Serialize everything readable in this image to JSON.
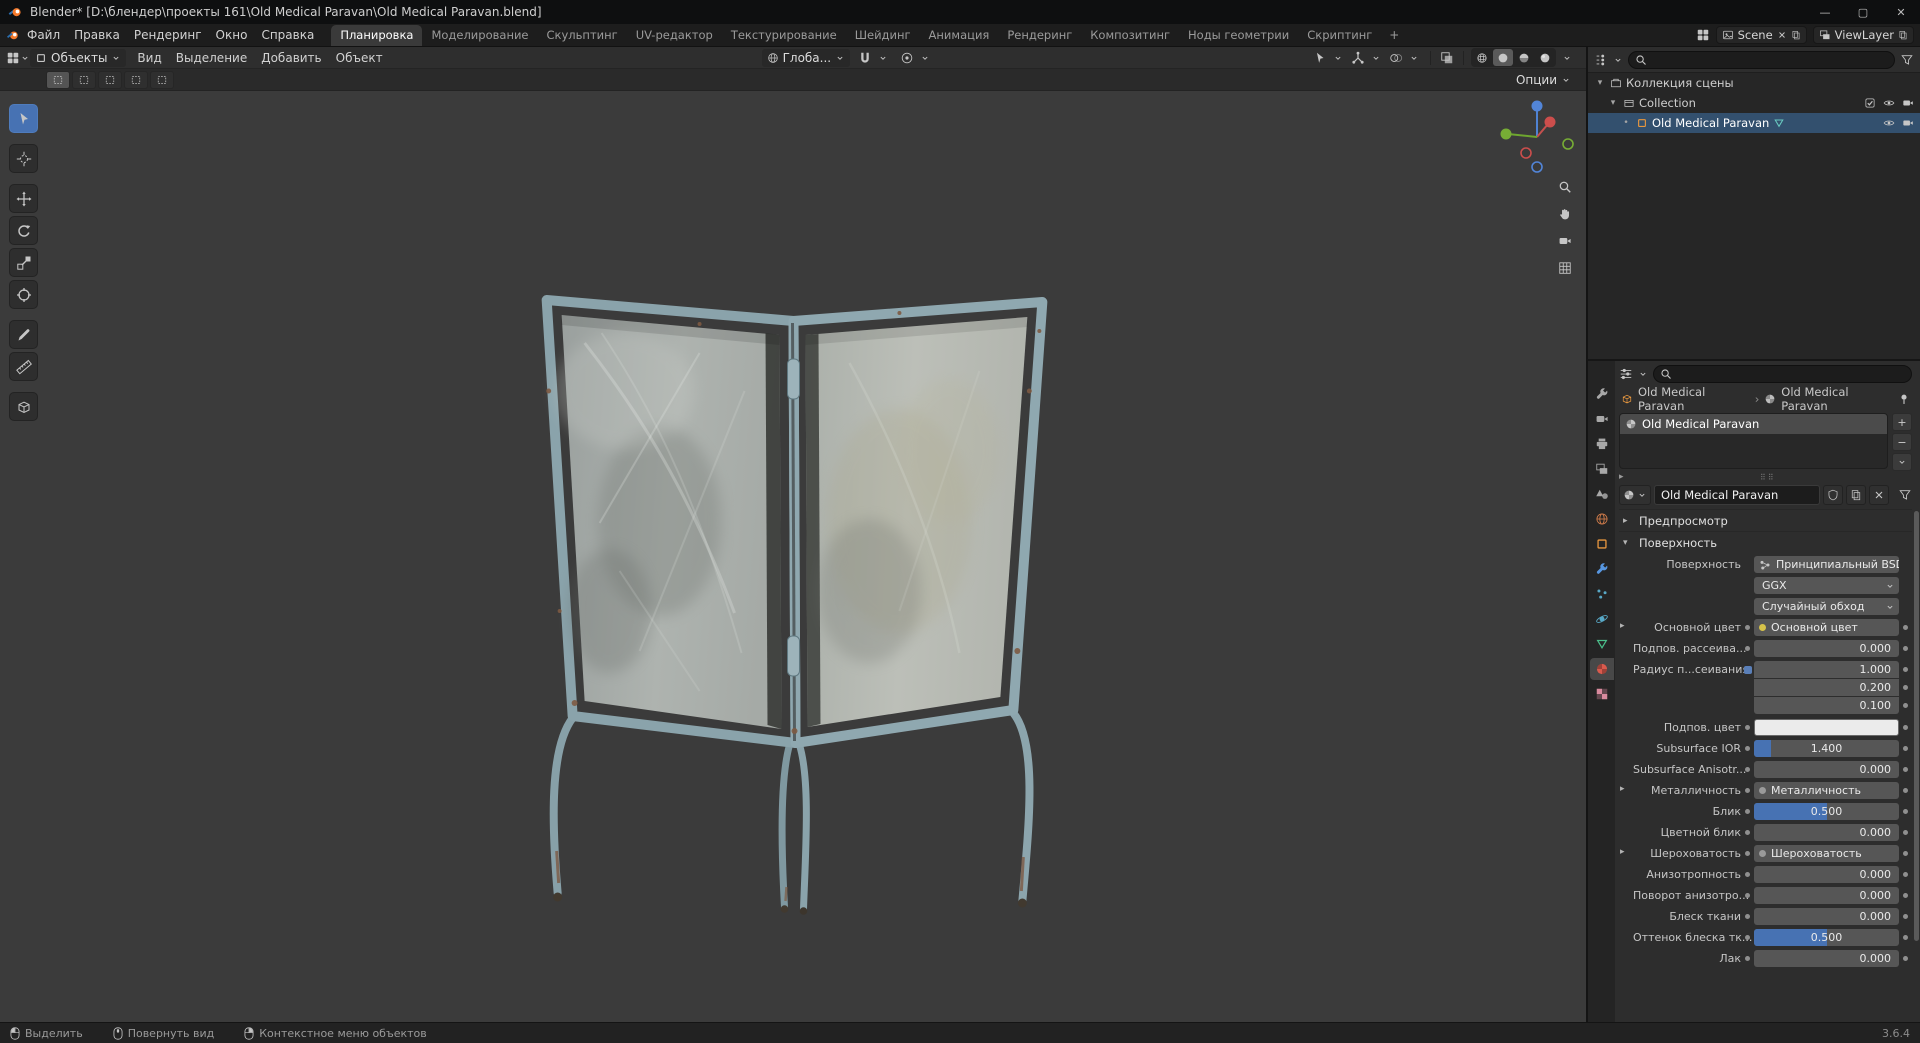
{
  "titlebar": {
    "title": "Blender* [D:\\блендер\\проекты 161\\Old Medical Paravan\\Old Medical Paravan.blend]",
    "minimize_glyph": "—",
    "maximize_glyph": "▢",
    "close_glyph": "✕"
  },
  "topbar": {
    "menus": [
      {
        "label": "Файл"
      },
      {
        "label": "Правка"
      },
      {
        "label": "Рендеринг"
      },
      {
        "label": "Окно"
      },
      {
        "label": "Справка"
      }
    ],
    "workspaces": [
      {
        "label": "Планировка",
        "active": true
      },
      {
        "label": "Моделирование"
      },
      {
        "label": "Скульптинг"
      },
      {
        "label": "UV-редактор"
      },
      {
        "label": "Текстурирование"
      },
      {
        "label": "Шейдинг"
      },
      {
        "label": "Анимация"
      },
      {
        "label": "Рендеринг"
      },
      {
        "label": "Композитинг"
      },
      {
        "label": "Ноды геометрии"
      },
      {
        "label": "Скриптинг"
      }
    ],
    "add_workspace_label": "+",
    "scene": {
      "label": "Scene"
    },
    "view_layer": {
      "label": "ViewLayer"
    }
  },
  "viewport": {
    "header": {
      "mode": "Объекты",
      "menus": [
        {
          "label": "Вид"
        },
        {
          "label": "Выделение"
        },
        {
          "label": "Добавить"
        },
        {
          "label": "Объект"
        }
      ],
      "orientation": "Глоба...",
      "options_label": "Опции"
    },
    "tool_settings": {
      "select_modes": [
        "set",
        "extend",
        "subtract",
        "invert",
        "intersect"
      ]
    },
    "toolbar": [
      {
        "name": "select-box",
        "active": true
      },
      {
        "name": "cursor"
      },
      {
        "name": "move"
      },
      {
        "name": "rotate"
      },
      {
        "name": "scale"
      },
      {
        "name": "transform"
      },
      {
        "name": "annotate"
      },
      {
        "name": "measure"
      },
      {
        "name": "add-cube"
      }
    ],
    "nav": [
      {
        "name": "zoom"
      },
      {
        "name": "pan-hand"
      },
      {
        "name": "camera-view"
      },
      {
        "name": "toggle-ortho"
      }
    ]
  },
  "outliner": {
    "rows": [
      {
        "label": "Коллекция сцены",
        "icon": "scenecol",
        "level": 0,
        "expander": "open"
      },
      {
        "label": "Collection",
        "icon": "collection",
        "level": 1,
        "expander": "open",
        "toggles": [
          "checkbox",
          "eye",
          "camera"
        ]
      },
      {
        "label": "Old Medical Paravan",
        "icon": "object",
        "data_icon": "mesh",
        "level": 2,
        "expander": "leaf",
        "selected": true,
        "toggles": [
          "eye",
          "camera"
        ]
      }
    ]
  },
  "properties": {
    "tabs": [
      {
        "name": "tool",
        "color": "#a8a8a8"
      },
      {
        "name": "render",
        "color": "#a8a8a8"
      },
      {
        "name": "output",
        "color": "#a8a8a8"
      },
      {
        "name": "view-layer",
        "color": "#a8a8a8"
      },
      {
        "name": "scene",
        "color": "#a8a8a8"
      },
      {
        "name": "world",
        "color": "#cf7b4a"
      },
      {
        "name": "object",
        "color": "#e8973f"
      },
      {
        "name": "modifiers",
        "color": "#5796e0"
      },
      {
        "name": "particles",
        "color": "#58a8c6"
      },
      {
        "name": "physics",
        "color": "#58a8c6"
      },
      {
        "name": "object-data",
        "color": "#4bbd8a"
      },
      {
        "name": "material",
        "color": "#d95a4d",
        "active": true
      },
      {
        "name": "texture",
        "color": "#d98a9e"
      }
    ],
    "breadcrumb": {
      "object": "Old Medical Paravan",
      "separator": "›",
      "material": "Old Medical Paravan"
    },
    "slot": {
      "name": "Old Medical Paravan",
      "add_label": "+",
      "remove_label": "−"
    },
    "name_field": {
      "value": "Old Medical Paravan"
    },
    "preview_section": "Предпросмотр",
    "surface_section": "Поверхность",
    "rows": [
      {
        "type": "node",
        "label": "Поверхность",
        "value": "Принципиальный BSDF"
      },
      {
        "type": "select",
        "label": "",
        "value": "GGX"
      },
      {
        "type": "select",
        "label": "",
        "value": "Случайный обход"
      },
      {
        "type": "link",
        "label": "Основной цвет",
        "value": "Основной цвет",
        "dot": "#d6c24a"
      },
      {
        "type": "number",
        "label": "Подпов. рассеива...",
        "value": "0.000"
      },
      {
        "type": "vector",
        "label": "Радиус п...сеивания",
        "values": [
          "1.000",
          "0.200",
          "0.100"
        ]
      },
      {
        "type": "color",
        "label": "Подпов. цвет",
        "swatch": "#ebebeb"
      },
      {
        "type": "slider",
        "label": "Subsurface IOR",
        "value": "1.400",
        "fill": 0.12
      },
      {
        "type": "number",
        "label": "Subsurface Anisotr...",
        "value": "0.000"
      },
      {
        "type": "link",
        "label": "Металличность",
        "value": "Металличность",
        "dot": "#9a9a9a"
      },
      {
        "type": "slider",
        "label": "Блик",
        "value": "0.500",
        "fill": 0.5
      },
      {
        "type": "number",
        "label": "Цветной блик",
        "value": "0.000"
      },
      {
        "type": "link",
        "label": "Шероховатость",
        "value": "Шероховатость",
        "dot": "#9a9a9a"
      },
      {
        "type": "number",
        "label": "Анизотропность",
        "value": "0.000"
      },
      {
        "type": "number",
        "label": "Поворот анизотро...",
        "value": "0.000"
      },
      {
        "type": "number",
        "label": "Блеск ткани",
        "value": "0.000"
      },
      {
        "type": "slider",
        "label": "Оттенок блеска тк...",
        "value": "0.500",
        "fill": 0.5
      },
      {
        "type": "number",
        "label": "Лак",
        "value": "0.000"
      }
    ]
  },
  "statusbar": {
    "hints": [
      {
        "icon": "mouse-left",
        "label": "Выделить"
      },
      {
        "icon": "mouse-middle",
        "label": "Повернуть вид"
      },
      {
        "icon": "mouse-right",
        "label": "Контекстное меню объектов"
      }
    ],
    "version": "3.6.4"
  },
  "colors": {
    "accent": "#4772b3",
    "frame": "#8aa3ab",
    "viewport_bg": "#3b3b3b"
  }
}
